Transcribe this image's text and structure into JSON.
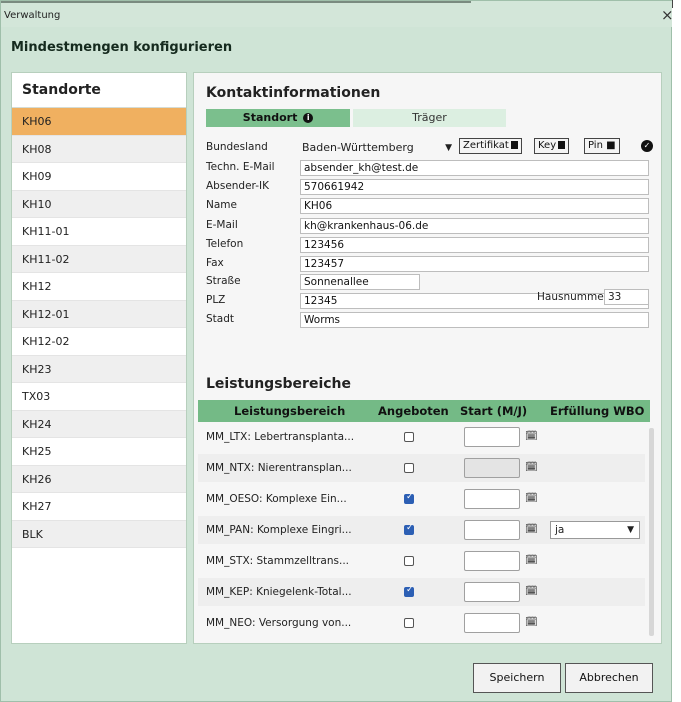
{
  "window": {
    "title": "Verwaltung",
    "close": "×"
  },
  "subtitle": "Mindestmengen konfigurieren",
  "locations": {
    "heading": "Standorte",
    "items": [
      "KH06",
      "KH08",
      "KH09",
      "KH10",
      "KH11-01",
      "KH11-02",
      "KH12",
      "KH12-01",
      "KH12-02",
      "KH23",
      "TX03",
      "KH24",
      "KH25",
      "KH26",
      "KH27",
      "BLK"
    ],
    "selected": "KH06"
  },
  "contact": {
    "heading": "Kontaktinformationen",
    "tabs": {
      "standort": "Standort",
      "traeger": "Träger"
    },
    "bundesland_label": "Bundesland",
    "bundesland_value": "Baden-Württemberg",
    "buttons": {
      "zertifikat": "Zertifikat",
      "key": "Key",
      "pin": "Pin"
    },
    "fields": [
      {
        "label": "Techn. E-Mail",
        "value": "absender_kh@test.de"
      },
      {
        "label": "Absender-IK",
        "value": "570661942"
      },
      {
        "label": "Name",
        "value": "KH06"
      },
      {
        "label": "E-Mail",
        "value": "kh@krankenhaus-06.de"
      },
      {
        "label": "Telefon",
        "value": "123456"
      },
      {
        "label": "Fax",
        "value": "123457"
      },
      {
        "label": "Straße",
        "value": "Sonnenallee"
      },
      {
        "label": "PLZ",
        "value": "12345"
      },
      {
        "label": "Stadt",
        "value": "Worms"
      }
    ],
    "hausnummer_label": "Hausnummer",
    "hausnummer_value": "33"
  },
  "services": {
    "heading": "Leistungsbereiche",
    "columns": [
      "Leistungsbereich",
      "Angeboten",
      "Start (M/J)",
      "Erfüllung WBO"
    ],
    "rows": [
      {
        "name": "MM_LTX: Lebertransplanta...",
        "offered": false,
        "date_enabled": true,
        "wbo": ""
      },
      {
        "name": "MM_NTX: Nierentransplan...",
        "offered": false,
        "date_enabled": false,
        "wbo": ""
      },
      {
        "name": "MM_OESO: Komplexe Ein...",
        "offered": true,
        "date_enabled": true,
        "wbo": ""
      },
      {
        "name": "MM_PAN: Komplexe Eingri...",
        "offered": true,
        "date_enabled": true,
        "wbo": "ja"
      },
      {
        "name": "MM_STX: Stammzelltrans...",
        "offered": false,
        "date_enabled": true,
        "wbo": ""
      },
      {
        "name": "MM_KEP: Kniegelenk-Total...",
        "offered": true,
        "date_enabled": true,
        "wbo": ""
      },
      {
        "name": "MM_NEO: Versorgung von...",
        "offered": false,
        "date_enabled": true,
        "wbo": ""
      }
    ]
  },
  "footer": {
    "save": "Speichern",
    "cancel": "Abbrechen"
  },
  "colors": {
    "accent": "#74ba86",
    "selected": "#f0b060",
    "window": "#cfe4d6"
  }
}
